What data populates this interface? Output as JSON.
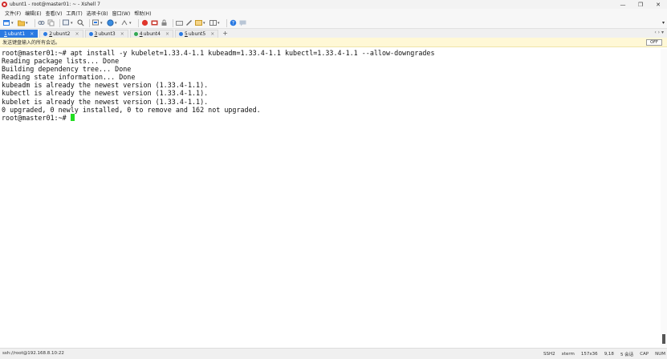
{
  "window": {
    "title": "ubunt1 - root@master01: ~ - Xshell 7",
    "controls": [
      "—",
      "❐",
      "✕"
    ]
  },
  "menu": [
    "文件(F)",
    "编辑(E)",
    "查看(V)",
    "工具(T)",
    "选项卡(B)",
    "窗口(W)",
    "帮助(H)"
  ],
  "toolbar": {
    "icons": [
      "new-session-icon",
      "open-folder-icon",
      "link-icon",
      "copy-icon",
      "find-icon",
      "zoom-icon",
      "color-scheme-icon",
      "globe-icon",
      "script-icon",
      "xftp-icon",
      "transfer-icon",
      "lock-icon",
      "keyboard-icon",
      "compose-icon",
      "layout-icon",
      "help-icon",
      "chat-icon"
    ],
    "right_glyph": "▾"
  },
  "tabs": [
    {
      "num": "1",
      "label": "ubunt1",
      "active": true,
      "dot_color": ""
    },
    {
      "num": "2",
      "label": "ubunt2",
      "active": false,
      "dot_color": "#2a7ae2"
    },
    {
      "num": "3",
      "label": "ubunt3",
      "active": false,
      "dot_color": "#2a7ae2"
    },
    {
      "num": "4",
      "label": "ubunt4",
      "active": false,
      "dot_color": "#34a853"
    },
    {
      "num": "5",
      "label": "ubunt5",
      "active": false,
      "dot_color": "#2a7ae2"
    }
  ],
  "tab_add": "+",
  "tab_nav": "‹ ›  ▾",
  "notice": {
    "text": "发送键盘输入的所有会话。",
    "off_label": "OFF"
  },
  "terminal": {
    "lines": [
      "root@master01:~# apt install -y kubelet=1.33.4-1.1 kubeadm=1.33.4-1.1 kubectl=1.33.4-1.1 --allow-downgrades",
      "Reading package lists... Done",
      "Building dependency tree... Done",
      "Reading state information... Done",
      "kubeadm is already the newest version (1.33.4-1.1).",
      "kubectl is already the newest version (1.33.4-1.1).",
      "kubelet is already the newest version (1.33.4-1.1).",
      "0 upgraded, 0 newly installed, 0 to remove and 162 not upgraded."
    ],
    "prompt": "root@master01:~# ",
    "cursor_color": "#22dd22"
  },
  "status": {
    "connection": "ssh://root@192.168.8.10:22",
    "protocol": "SSH2",
    "terminal_type": "xterm",
    "size": "157x36",
    "position": "9,18",
    "sessions": "5 会话",
    "caps": "CAP",
    "num": "NUM"
  }
}
